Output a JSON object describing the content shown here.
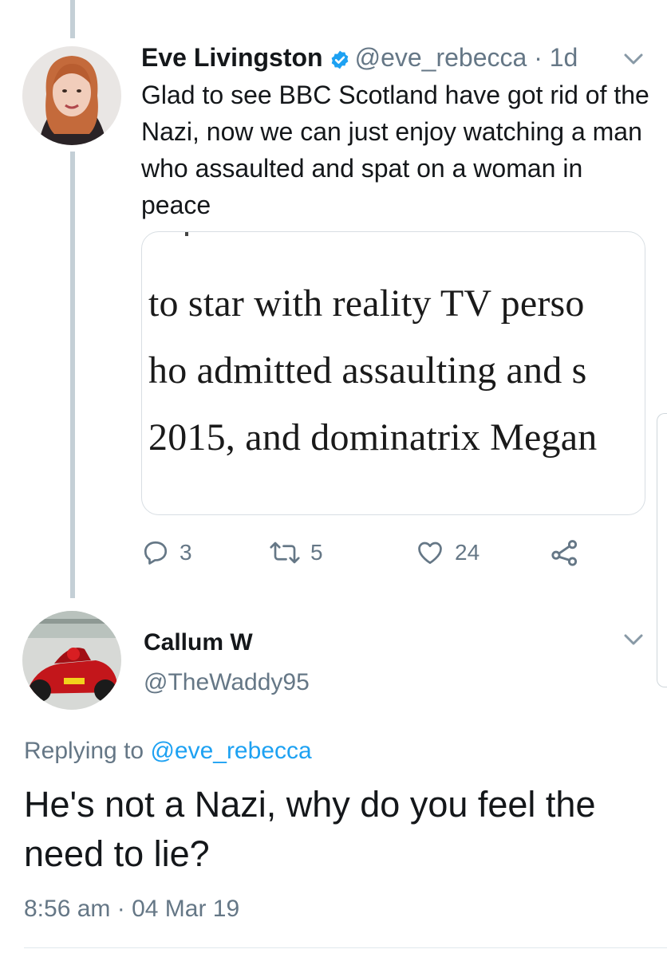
{
  "original_tweet": {
    "author_name": "Eve Livingston",
    "verified": true,
    "handle": "@eve_rebecca",
    "separator": "·",
    "age": "1d",
    "text": "Glad to see BBC Scotland have got rid of the Nazi, now we can just enjoy watching a man who assaulted and spat on a woman in peace",
    "media_excerpt": [
      "to star with reality TV perso",
      "ho admitted assaulting and s",
      "2015, and dominatrix Megan"
    ],
    "actions": {
      "replies": "3",
      "retweets": "5",
      "likes": "24"
    }
  },
  "reply_tweet": {
    "author_name": "Callum W",
    "handle": "@TheWaddy95",
    "replying_prefix": "Replying to",
    "replying_to": "@eve_rebecca",
    "text": "He's not a Nazi, why do you feel the need to lie?",
    "time": "8:56 am",
    "separator": "·",
    "date": "04 Mar 19"
  },
  "colors": {
    "link": "#1da1f2",
    "muted": "#657786",
    "thread_line": "#c4cfd6",
    "verified": "#1da1f2"
  },
  "icons": [
    "chevron-down-icon",
    "verified-badge-icon",
    "reply-icon",
    "retweet-icon",
    "like-icon",
    "share-icon"
  ]
}
